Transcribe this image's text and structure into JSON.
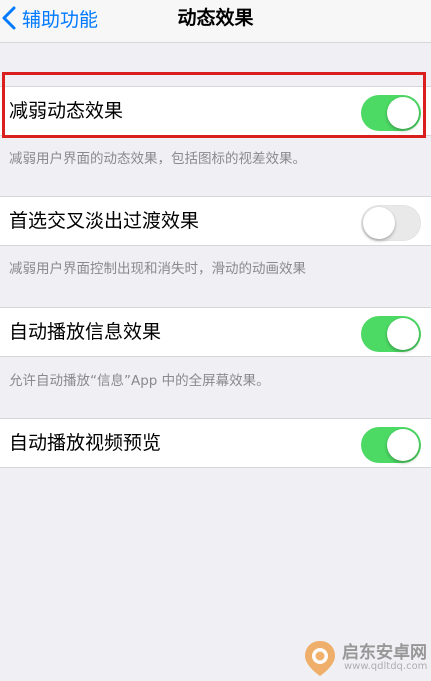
{
  "nav": {
    "back_label": "辅助功能",
    "title": "动态效果"
  },
  "settings": [
    {
      "label": "减弱动态效果",
      "enabled": true,
      "note": "减弱用户界面的动态效果，包括图标的视差效果。"
    },
    {
      "label": "首选交叉淡出过渡效果",
      "enabled": false,
      "note": "减弱用户界面控制出现和消失时，滑动的动画效果"
    },
    {
      "label": "自动播放信息效果",
      "enabled": true,
      "note": "允许自动播放“信息”App 中的全屏幕效果。"
    },
    {
      "label": "自动播放视频预览",
      "enabled": true,
      "note": ""
    }
  ],
  "watermark": {
    "text": "启东安卓网",
    "url": "www.qdltdq.com"
  },
  "colors": {
    "accent": "#007aff",
    "toggle_on": "#4cd964",
    "toggle_off": "#e9e9ea",
    "highlight": "#d9201f",
    "background": "#efeff4"
  },
  "icons": {
    "back": "chevron-left-icon",
    "watermark_logo": "pin-logo-icon"
  }
}
